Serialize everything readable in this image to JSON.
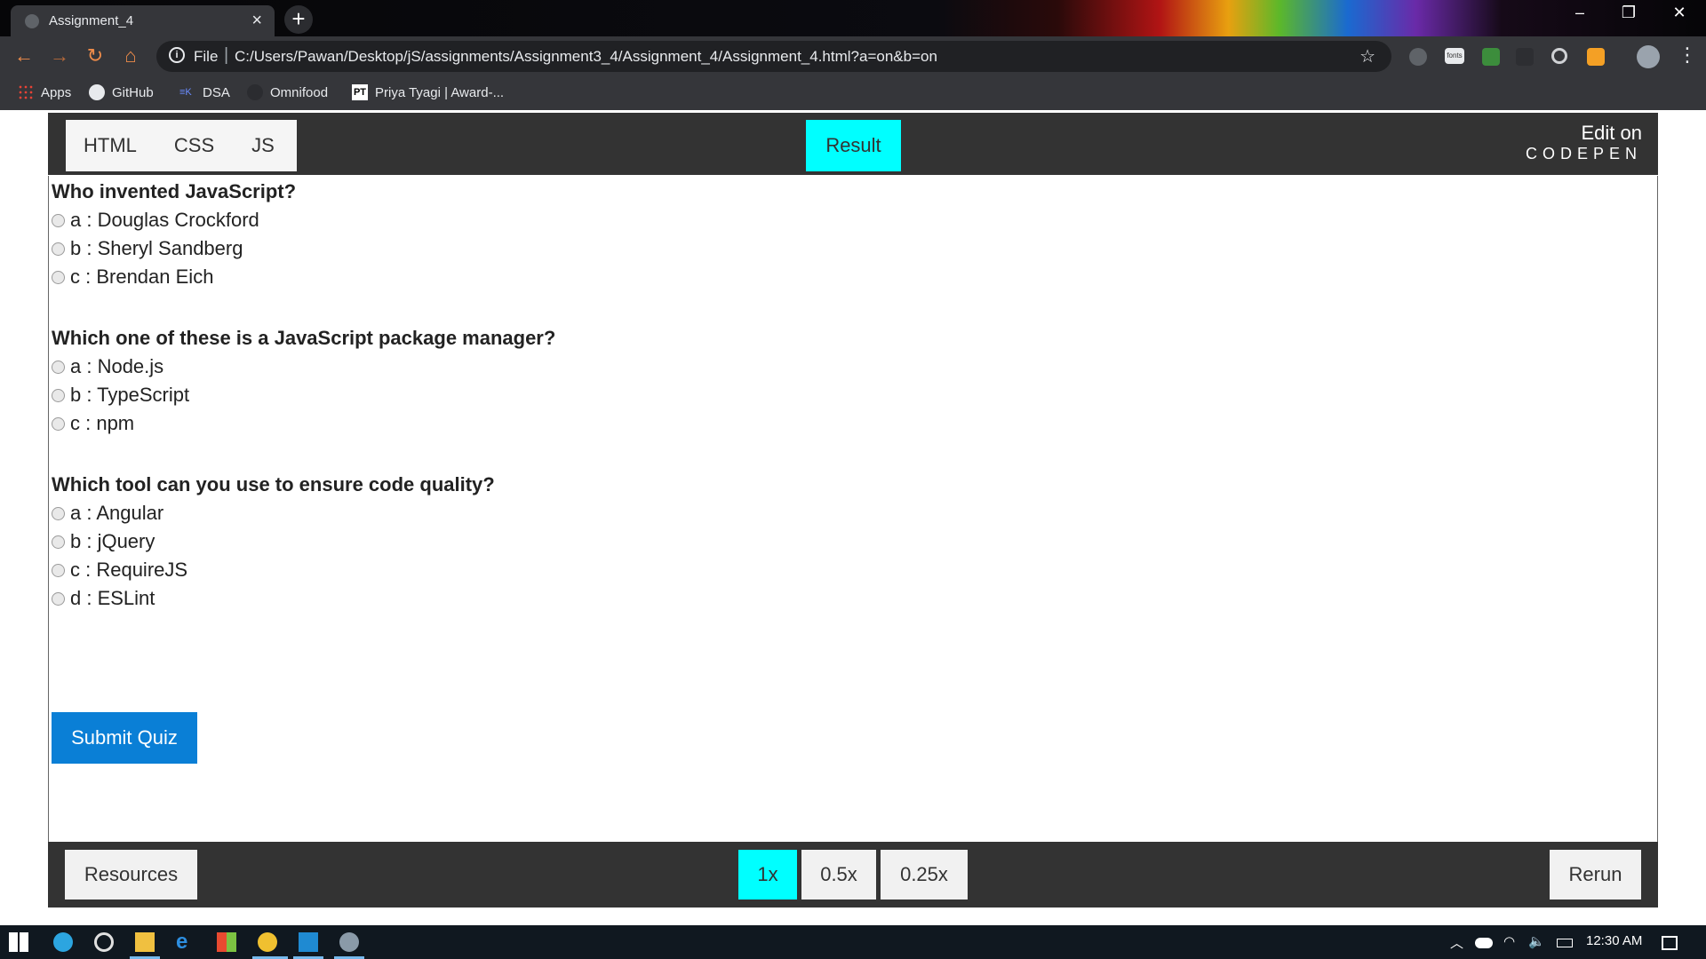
{
  "browser": {
    "tab_title": "Assignment_4",
    "file_label": "File",
    "url": "C:/Users/Pawan/Desktop/jS/assignments/Assignment3_4/Assignment_4/Assignment_4.html?a=on&b=on",
    "bookmarks": [
      {
        "label": "Apps",
        "icon": "apps-grid-icon"
      },
      {
        "label": "GitHub",
        "icon": "github-icon"
      },
      {
        "label": "DSA",
        "icon": "dsa-icon"
      },
      {
        "label": "Omnifood",
        "icon": "omnifood-icon"
      },
      {
        "label": "Priya Tyagi | Award-...",
        "icon": "pt-icon"
      }
    ],
    "ext_fonts_label": "fonts"
  },
  "codepen": {
    "tabs": [
      "HTML",
      "CSS",
      "JS"
    ],
    "result_label": "Result",
    "edit_on": "Edit on",
    "brand": "CODEPEN"
  },
  "quiz": {
    "questions": [
      {
        "title": "Who invented JavaScript?",
        "options": [
          "a : Douglas Crockford",
          "b : Sheryl Sandberg",
          "c : Brendan Eich"
        ]
      },
      {
        "title": "Which one of these is a JavaScript package manager?",
        "options": [
          "a : Node.js",
          "b : TypeScript",
          "c : npm"
        ]
      },
      {
        "title": "Which tool can you use to ensure code quality?",
        "options": [
          "a : Angular",
          "b : jQuery",
          "c : RequireJS",
          "d : ESLint"
        ]
      }
    ],
    "submit_label": "Submit Quiz"
  },
  "footer": {
    "resources_label": "Resources",
    "speeds": [
      "1x",
      "0.5x",
      "0.25x"
    ],
    "active_speed": "1x",
    "rerun_label": "Rerun"
  },
  "taskbar": {
    "time": "12:30 AM"
  },
  "colors": {
    "accent_cyan": "#00ffff",
    "submit_blue": "#0a7fd6",
    "codepen_bar": "#333333"
  }
}
